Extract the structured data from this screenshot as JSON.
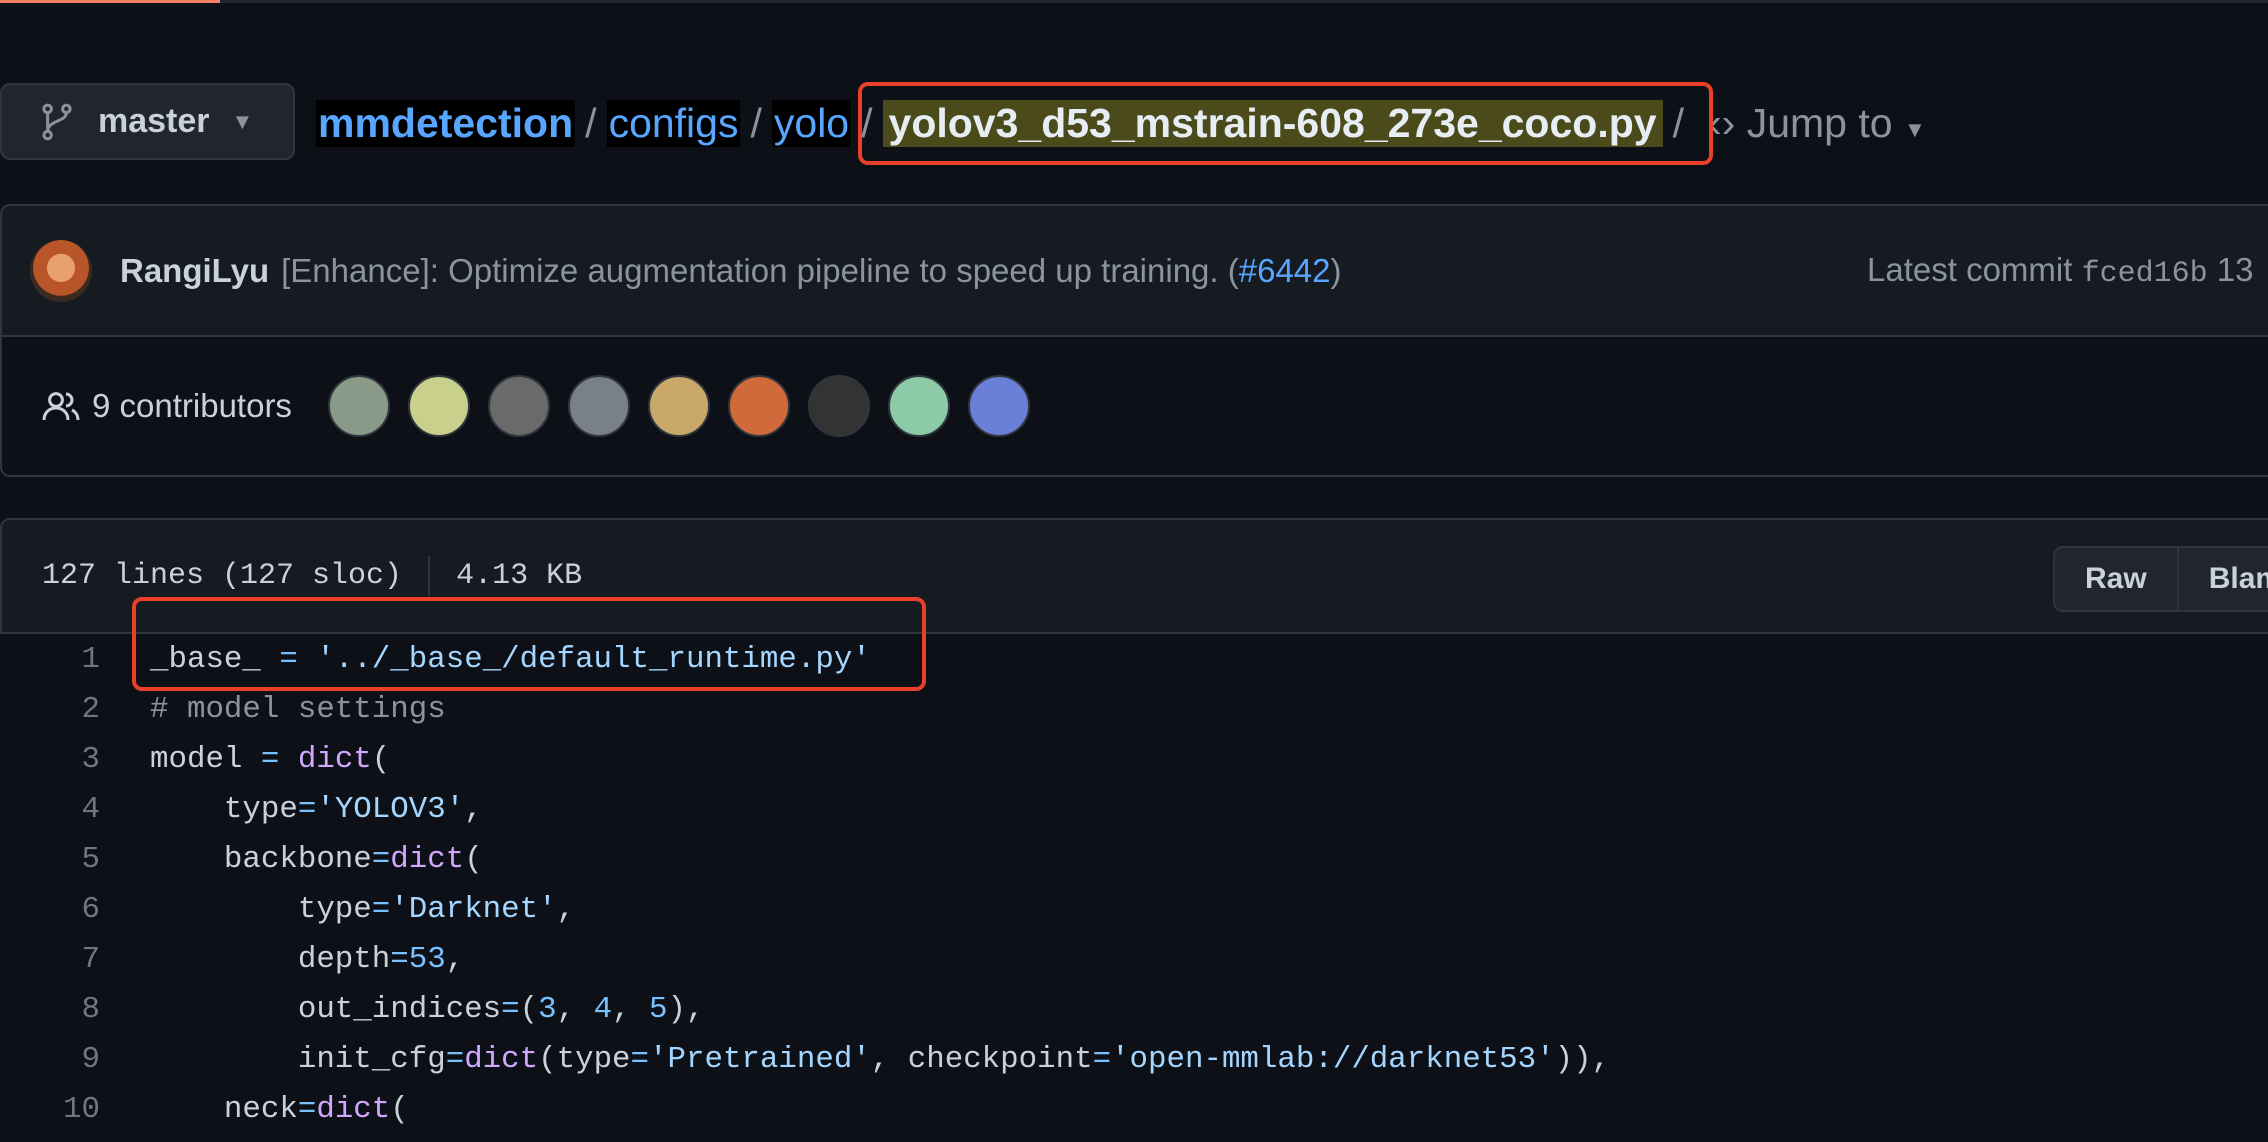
{
  "branch": {
    "name": "master",
    "icon": "git-branch-icon"
  },
  "breadcrumb": {
    "repo": "mmdetection",
    "dirs": [
      "configs",
      "yolo"
    ],
    "file": "yolov3_d53_mstrain-608_273e_coco.py",
    "separator": "/",
    "jump_to": "Jump to"
  },
  "commit": {
    "author": "RangiLyu",
    "message": "[Enhance]: Optimize augmentation pipeline to speed up training. (",
    "pr": "#6442",
    "message_end": ")",
    "latest_label": "Latest commit",
    "sha": "fced16b",
    "trail": "13"
  },
  "contributors": {
    "label": "9 contributors",
    "avatars": [
      "#8a9a88",
      "#c8d08c",
      "#6a6a6a",
      "#7a8088",
      "#c9a86a",
      "#d06a3a",
      "#333333",
      "#8ccaa8",
      "#6a80d8"
    ]
  },
  "file": {
    "lines": "127 lines (127 sloc)",
    "size": "4.13 KB",
    "raw": "Raw",
    "blame": "Blam"
  },
  "colors": {
    "background": "#0d1117",
    "accent": "#58a6ff",
    "highlight_box": "#e8402a"
  },
  "code": [
    {
      "n": "1",
      "t": [
        [
          "_base_ ",
          "d"
        ],
        [
          "=",
          "o"
        ],
        [
          " ",
          "d"
        ],
        [
          "'../_base_/default_runtime.py'",
          "s"
        ]
      ]
    },
    {
      "n": "2",
      "t": [
        [
          "# model settings",
          "c"
        ]
      ]
    },
    {
      "n": "3",
      "t": [
        [
          "model ",
          "d"
        ],
        [
          "=",
          "o"
        ],
        [
          " ",
          "d"
        ],
        [
          "dict",
          "f"
        ],
        [
          "(",
          "d"
        ]
      ]
    },
    {
      "n": "4",
      "t": [
        [
          "    type",
          "d"
        ],
        [
          "=",
          "o"
        ],
        [
          "'YOLOV3'",
          "s"
        ],
        [
          ",",
          "d"
        ]
      ]
    },
    {
      "n": "5",
      "t": [
        [
          "    backbone",
          "d"
        ],
        [
          "=",
          "o"
        ],
        [
          "dict",
          "f"
        ],
        [
          "(",
          "d"
        ]
      ]
    },
    {
      "n": "6",
      "t": [
        [
          "        type",
          "d"
        ],
        [
          "=",
          "o"
        ],
        [
          "'Darknet'",
          "s"
        ],
        [
          ",",
          "d"
        ]
      ]
    },
    {
      "n": "7",
      "t": [
        [
          "        depth",
          "d"
        ],
        [
          "=",
          "o"
        ],
        [
          "53",
          "o"
        ],
        [
          ",",
          "d"
        ]
      ]
    },
    {
      "n": "8",
      "t": [
        [
          "        out_indices",
          "d"
        ],
        [
          "=",
          "o"
        ],
        [
          "(",
          "d"
        ],
        [
          "3",
          "o"
        ],
        [
          ", ",
          "d"
        ],
        [
          "4",
          "o"
        ],
        [
          ", ",
          "d"
        ],
        [
          "5",
          "o"
        ],
        [
          "),",
          "d"
        ]
      ]
    },
    {
      "n": "9",
      "t": [
        [
          "        init_cfg",
          "d"
        ],
        [
          "=",
          "o"
        ],
        [
          "dict",
          "f"
        ],
        [
          "(type",
          "d"
        ],
        [
          "=",
          "o"
        ],
        [
          "'Pretrained'",
          "s"
        ],
        [
          ", checkpoint",
          "d"
        ],
        [
          "=",
          "o"
        ],
        [
          "'open-mmlab://darknet53'",
          "s"
        ],
        [
          ")),",
          "d"
        ]
      ]
    },
    {
      "n": "10",
      "t": [
        [
          "    neck",
          "d"
        ],
        [
          "=",
          "o"
        ],
        [
          "dict",
          "f"
        ],
        [
          "(",
          "d"
        ]
      ]
    }
  ]
}
